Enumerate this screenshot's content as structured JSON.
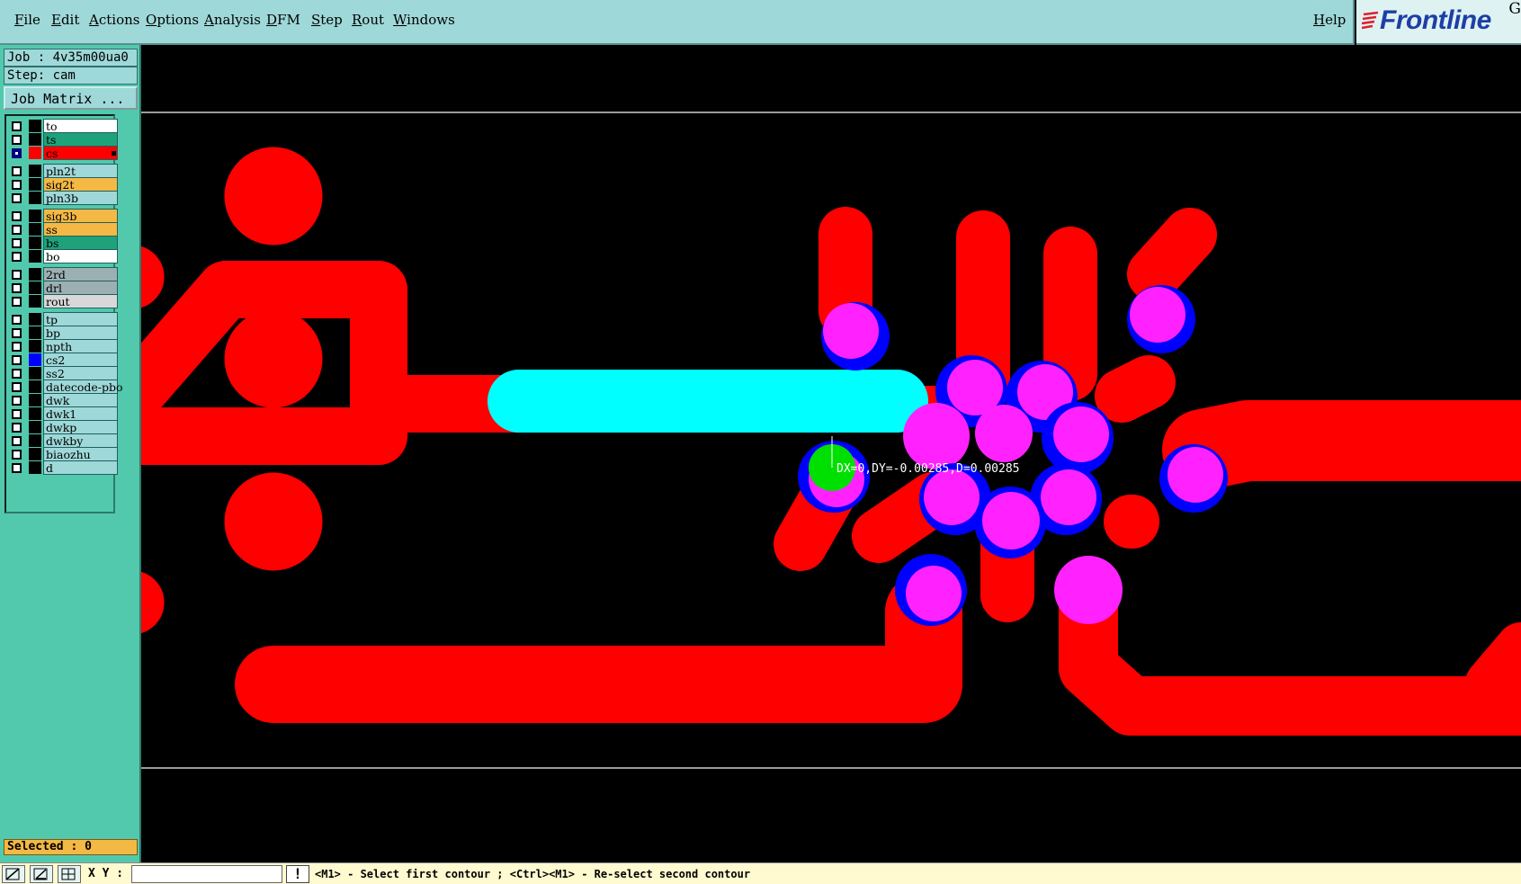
{
  "menubar": {
    "items": [
      "File",
      "Edit",
      "Actions",
      "Options",
      "Analysis",
      "DFM",
      "Step",
      "Rout",
      "Windows"
    ],
    "help": "Help"
  },
  "logo": {
    "text": "Frontline",
    "corner": "G"
  },
  "job": {
    "job_label": "Job : 4v35m00ua0",
    "step_label": "Step: cam",
    "matrix_button": "Job Matrix ..."
  },
  "layers": [
    {
      "name": "to",
      "color": "#ffffff",
      "swatch": "#000000",
      "checked": false
    },
    {
      "name": "ts",
      "color": "#1fa27a",
      "swatch": "#000000",
      "checked": false
    },
    {
      "name": "cs",
      "color": "#ff0000",
      "swatch": "#ff0000",
      "checked": true
    },
    {
      "name": "pln2t",
      "color": "#9fd8d8",
      "swatch": "#000000",
      "checked": false
    },
    {
      "name": "sig2t",
      "color": "#f4b844",
      "swatch": "#000000",
      "checked": false
    },
    {
      "name": "pln3b",
      "color": "#9fd8d8",
      "swatch": "#000000",
      "checked": false
    },
    {
      "name": "sig3b",
      "color": "#f4b844",
      "swatch": "#000000",
      "checked": false
    },
    {
      "name": "ss",
      "color": "#f4b844",
      "swatch": "#000000",
      "checked": false
    },
    {
      "name": "bs",
      "color": "#1fa27a",
      "swatch": "#000000",
      "checked": false
    },
    {
      "name": "bo",
      "color": "#ffffff",
      "swatch": "#000000",
      "checked": false
    },
    {
      "name": "2rd",
      "color": "#9cb0b4",
      "swatch": "#000000",
      "checked": false
    },
    {
      "name": "drl",
      "color": "#9cb0b4",
      "swatch": "#000000",
      "checked": false
    },
    {
      "name": "rout",
      "color": "#d8d8d8",
      "swatch": "#000000",
      "checked": false
    },
    {
      "name": "tp",
      "color": "#9fd8d8",
      "swatch": "#000000",
      "checked": false
    },
    {
      "name": "bp",
      "color": "#9fd8d8",
      "swatch": "#000000",
      "checked": false
    },
    {
      "name": "npth",
      "color": "#9fd8d8",
      "swatch": "#000000",
      "checked": false
    },
    {
      "name": "cs2",
      "color": "#9fd8d8",
      "swatch": "#0000ff",
      "checked": false
    },
    {
      "name": "ss2",
      "color": "#9fd8d8",
      "swatch": "#000000",
      "checked": false
    },
    {
      "name": "datecode-pbo",
      "color": "#9fd8d8",
      "swatch": "#000000",
      "checked": false
    },
    {
      "name": "dwk",
      "color": "#9fd8d8",
      "swatch": "#000000",
      "checked": false
    },
    {
      "name": "dwk1",
      "color": "#9fd8d8",
      "swatch": "#000000",
      "checked": false
    },
    {
      "name": "dwkp",
      "color": "#9fd8d8",
      "swatch": "#000000",
      "checked": false
    },
    {
      "name": "dwkby",
      "color": "#9fd8d8",
      "swatch": "#000000",
      "checked": false
    },
    {
      "name": "biaozhu",
      "color": "#9fd8d8",
      "swatch": "#000000",
      "checked": false
    },
    {
      "name": "d",
      "color": "#9fd8d8",
      "swatch": "#000000",
      "checked": false
    }
  ],
  "selected_label": "Selected : 0",
  "measurement": "DX=0,DY=-0.00285,D=0.00285",
  "statusbar": {
    "xy_label": "X Y :",
    "xy_value": "",
    "excl": "!",
    "prompt": "<M1> - Select first contour ; <Ctrl><M1> - Re-select second contour"
  },
  "colors": {
    "trace": "#ff0000",
    "pad_highlight": "#ff22ff",
    "pad_ring": "#0000ff",
    "slot": "#00ffff",
    "marker": "#00e000"
  }
}
